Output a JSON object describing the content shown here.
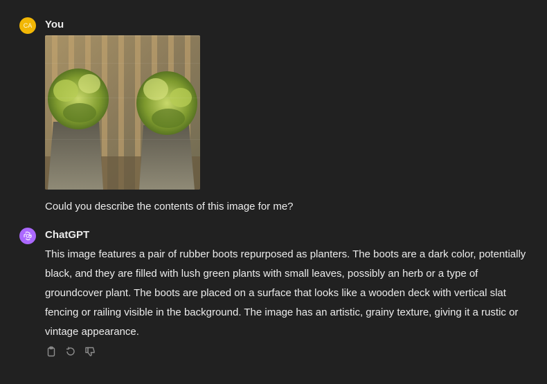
{
  "user": {
    "avatar_initials": "CA",
    "avatar_color": "#f2b705",
    "author": "You",
    "message": "Could you describe the contents of this image for me?"
  },
  "assistant": {
    "author": "ChatGPT",
    "avatar_color": "#ab68ff",
    "message": "This image features a pair of rubber boots repurposed as planters. The boots are a dark color, potentially black, and they are filled with lush green plants with small leaves, possibly an herb or a type of groundcover plant. The boots are placed on a surface that looks like a wooden deck with vertical slat fencing or railing visible in the background. The image has an artistic, grainy texture, giving it a rustic or vintage appearance."
  },
  "actions": [
    {
      "icon": "clipboard-icon"
    },
    {
      "icon": "regenerate-icon"
    },
    {
      "icon": "thumbs-down-icon"
    }
  ]
}
